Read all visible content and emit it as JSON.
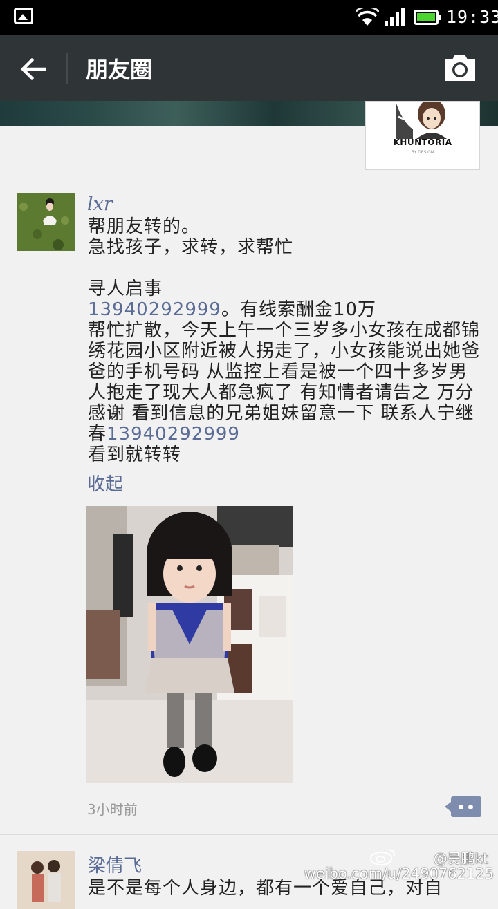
{
  "status_bar": {
    "time": "19:33",
    "icons": [
      "image-notification-icon",
      "wifi-icon",
      "signal-icon",
      "battery-icon"
    ],
    "battery_color": "#4cd430"
  },
  "header": {
    "back_icon": "arrow-left-icon",
    "title": "朋友圈",
    "camera_icon": "camera-icon",
    "background": "#2f3536"
  },
  "cover": {
    "avatar_logo_text": "KHUNTORIA",
    "avatar_logo_subtext": "BY DESIGN"
  },
  "posts": [
    {
      "username": "lxr",
      "body": {
        "line1": "帮朋友转的。",
        "line2": "急找孩子，求转，求帮忙",
        "line3": "寻人启事",
        "phone1": "13940292999",
        "after_phone1": "。有线索酬金10万",
        "main_text": "帮忙扩散，今天上午一个三岁多小女孩在成都锦绣花园小区附近被人拐走了，小女孩能说出她爸爸的手机号码 从监控上看是被一个四十多岁男人抱走了现大人都急疯了 有知情者请告之 万分感谢 看到信息的兄弟姐妹留意一下 联系人宁继春",
        "phone2": "13940292999",
        "last_line": "看到就转转"
      },
      "collapse_label": "收起",
      "timestamp": "3小时前",
      "comment_icon": "comment-dots-icon",
      "link_color": "#5a6c96"
    },
    {
      "username": "梁倩飞",
      "text_preview": "是不是每个人身边，都有一个爱自己，对自"
    }
  ],
  "watermark": {
    "handle": "@吴鹏kt",
    "url": "weibo.com/u/2490762125"
  }
}
